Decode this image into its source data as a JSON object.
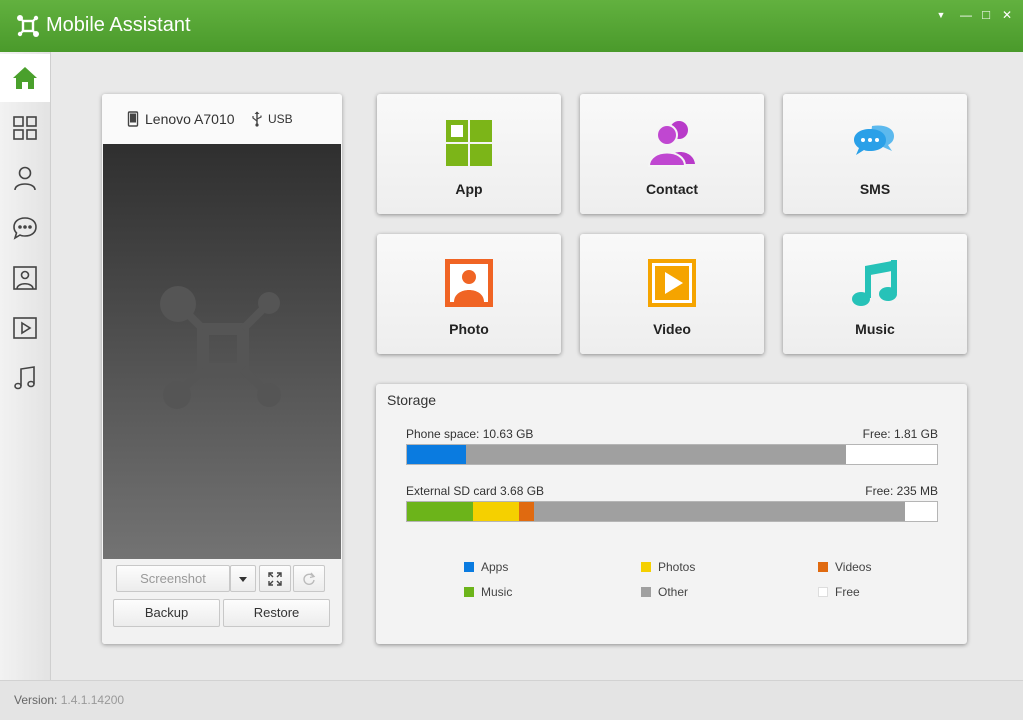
{
  "app": {
    "title": "Mobile Assistant"
  },
  "window_controls": {
    "menu": "▼",
    "minimize": "—",
    "maximize": "□",
    "close": "✕"
  },
  "sidebar": {
    "items": [
      {
        "icon": "home-icon",
        "active": true
      },
      {
        "icon": "apps-grid-icon"
      },
      {
        "icon": "contact-icon"
      },
      {
        "icon": "message-icon"
      },
      {
        "icon": "photo-icon"
      },
      {
        "icon": "video-icon"
      },
      {
        "icon": "music-icon"
      }
    ]
  },
  "device": {
    "name": "Lenovo A7010",
    "connection": "USB",
    "buttons": {
      "screenshot": "Screenshot",
      "backup": "Backup",
      "restore": "Restore"
    }
  },
  "tiles": [
    {
      "label": "App",
      "icon": "app-icon",
      "color": "#7cb518"
    },
    {
      "label": "Contact",
      "icon": "contact-icon",
      "color": "#b83ac9"
    },
    {
      "label": "SMS",
      "icon": "sms-icon",
      "color": "#2aa0e8"
    },
    {
      "label": "Photo",
      "icon": "photo-icon",
      "color": "#f06424"
    },
    {
      "label": "Video",
      "icon": "video-icon",
      "color": "#f5a400"
    },
    {
      "label": "Music",
      "icon": "music-icon",
      "color": "#26c2b8"
    }
  ],
  "storage": {
    "title": "Storage",
    "phone": {
      "label": "Phone space: 10.63 GB",
      "free_label": "Free: 1.81 GB",
      "fractions": {
        "apps": 0.112,
        "other": 0.717,
        "free": 0.171
      }
    },
    "sd": {
      "label": "External SD card 3.68 GB",
      "free_label": "Free: 235 MB",
      "fractions": {
        "music": 0.125,
        "photos": 0.086,
        "videos": 0.028,
        "other": 0.7,
        "free": 0.061
      }
    },
    "legend": [
      {
        "label": "Apps",
        "color": "#0a7be0"
      },
      {
        "label": "Photos",
        "color": "#f5d000"
      },
      {
        "label": "Videos",
        "color": "#e06a10"
      },
      {
        "label": "Music",
        "color": "#6cb41a"
      },
      {
        "label": "Other",
        "color": "#a0a0a0"
      },
      {
        "label": "Free",
        "color": "#ffffff"
      }
    ]
  },
  "footer": {
    "version_label": "Version:",
    "version": "1.4.1.14200"
  }
}
